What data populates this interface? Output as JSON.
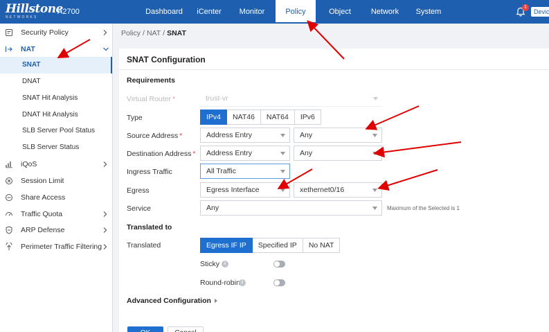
{
  "header": {
    "logo": "Hillstone",
    "logo_sub": "NETWORKS",
    "model": "A2700",
    "nav": [
      "Dashboard",
      "iCenter",
      "Monitor",
      "Policy",
      "Object",
      "Network",
      "System"
    ],
    "active_nav": "Policy",
    "notifications": "1",
    "device_label": "Devic"
  },
  "sidebar": {
    "items": [
      {
        "label": "Security Policy",
        "icon": "security-policy-icon"
      },
      {
        "label": "NAT",
        "icon": "nat-icon"
      },
      {
        "label": "iQoS",
        "icon": "iqos-icon"
      },
      {
        "label": "Session Limit",
        "icon": "session-limit-icon"
      },
      {
        "label": "Share Access",
        "icon": "share-access-icon"
      },
      {
        "label": "Traffic Quota",
        "icon": "traffic-quota-icon"
      },
      {
        "label": "ARP Defense",
        "icon": "arp-defense-icon"
      },
      {
        "label": "Perimeter Traffic Filtering",
        "icon": "perimeter-filter-icon"
      }
    ],
    "nat_children": [
      "SNAT",
      "DNAT",
      "SNAT Hit Analysis",
      "DNAT Hit Analysis",
      "SLB Server Pool Status",
      "SLB Server Status"
    ],
    "active_child": "SNAT"
  },
  "breadcrumb": {
    "parts": [
      "Policy",
      "NAT"
    ],
    "current": "SNAT"
  },
  "form": {
    "title": "SNAT Configuration",
    "requirements": "Requirements",
    "virtual_router_label": "Virtual Router",
    "virtual_router_value": "trust-vr",
    "type_label": "Type",
    "type_options": [
      "IPv4",
      "NAT46",
      "NAT64",
      "IPv6"
    ],
    "type_selected": "IPv4",
    "source_label": "Source Address",
    "source_kind": "Address Entry",
    "source_value": "Any",
    "dest_label": "Destination Address",
    "dest_kind": "Address Entry",
    "dest_value": "Any",
    "ingress_label": "Ingress Traffic",
    "ingress_value": "All Traffic",
    "egress_label": "Egress",
    "egress_kind": "Egress Interface",
    "egress_value": "xethernet0/16",
    "service_label": "Service",
    "service_value": "Any",
    "service_hint": "Maximum of the Selected is 1",
    "translated_section": "Translated to",
    "translated_label": "Translated",
    "translated_options": [
      "Egress IF IP",
      "Specified IP",
      "No NAT"
    ],
    "translated_selected": "Egress IF IP",
    "sticky_label": "Sticky",
    "round_robin_label": "Round-robin",
    "advanced": "Advanced Configuration",
    "ok": "OK",
    "cancel": "Cancel"
  },
  "colors": {
    "header": "#1f5fb0",
    "primary": "#1f6fd1",
    "annotation": "#e00000"
  }
}
